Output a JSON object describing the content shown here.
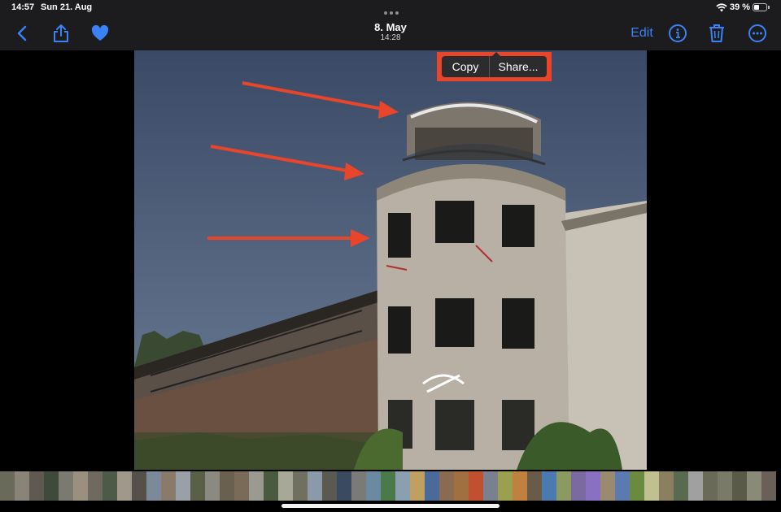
{
  "status_bar": {
    "time": "14:57",
    "date": "Sun 21. Aug",
    "battery": "39 %"
  },
  "toolbar": {
    "photo_date": "8. May",
    "photo_time": "14:28",
    "edit_label": "Edit",
    "icons": [
      "chevron-left-icon",
      "share-icon",
      "heart-icon",
      "info-icon",
      "trash-icon",
      "ellipsis-icon"
    ]
  },
  "context_menu": {
    "copy_label": "Copy",
    "share_label": "Share..."
  },
  "colors": {
    "accent": "#3b82f6",
    "highlight_box": "#e8452a",
    "arrow": "#e8452a",
    "toolbar_bg": "#1c1c1e"
  },
  "thumbnails": {
    "colors": [
      "#6a6a5a",
      "#8a8378",
      "#5e5a52",
      "#3f4a3a",
      "#7b7a70",
      "#9a9080",
      "#6e6a60",
      "#4d5a48",
      "#a0988a",
      "#55504a",
      "#7a8a9a",
      "#8a7a6a",
      "#9aa0a8",
      "#5a6048",
      "#8a8a80",
      "#6a6050",
      "#7a6a58",
      "#9a9a90",
      "#4a5a40",
      "#a8a898",
      "#707060",
      "#8a9aa8",
      "#5a5a50",
      "#3a4a60",
      "#7a7a78",
      "#6a8aa0",
      "#4a7a4a",
      "#8aa0b0",
      "#c0a060",
      "#4a6a9a",
      "#8a6a50",
      "#a07040",
      "#c05030",
      "#7a8090",
      "#9aa050",
      "#c08040",
      "#6a5a48",
      "#4a7ab0",
      "#8a9a60",
      "#7a6aa0",
      "#8a70c0",
      "#9a8a70",
      "#5a7ab0",
      "#6a8a40",
      "#c0c090",
      "#8a8060",
      "#5a6a50",
      "#a0a0a0",
      "#6a6a58",
      "#7a7a68",
      "#5a5a48",
      "#8a8a78",
      "#6a6058"
    ]
  }
}
